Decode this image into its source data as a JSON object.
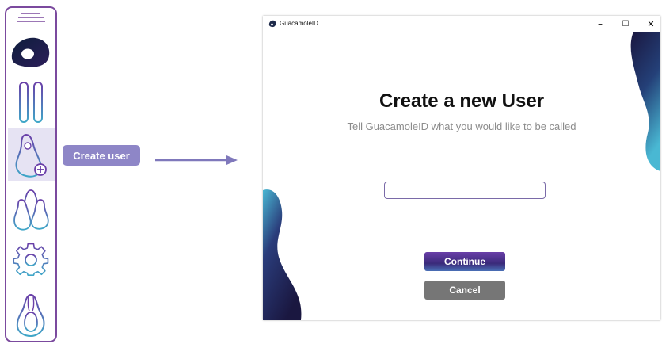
{
  "callout": {
    "label": "Create user"
  },
  "nav": {
    "items": [
      {
        "icon": "menu-icon"
      },
      {
        "icon": "guacamole-logo-icon"
      },
      {
        "icon": "pause-icon"
      },
      {
        "icon": "add-user-icon",
        "active": true
      },
      {
        "icon": "users-group-icon"
      },
      {
        "icon": "settings-gear-icon"
      },
      {
        "icon": "avocado-icon"
      }
    ]
  },
  "window": {
    "title": "GuacamoleID",
    "controls": {
      "minimize": "–",
      "maximize": "☐",
      "close": "✕"
    },
    "heading": "Create a new User",
    "subtitle": "Tell GuacamoleID what you would like to be called",
    "name_input": {
      "value": "",
      "placeholder": ""
    },
    "continue_label": "Continue",
    "cancel_label": "Cancel"
  },
  "colors": {
    "accent_purple": "#7b4a9e",
    "callout": "#8e86c7",
    "continue_button": "#4b3590",
    "cancel_button": "#767676",
    "blob_dark": "#1e1b4a",
    "blob_light": "#3fa7c8"
  }
}
